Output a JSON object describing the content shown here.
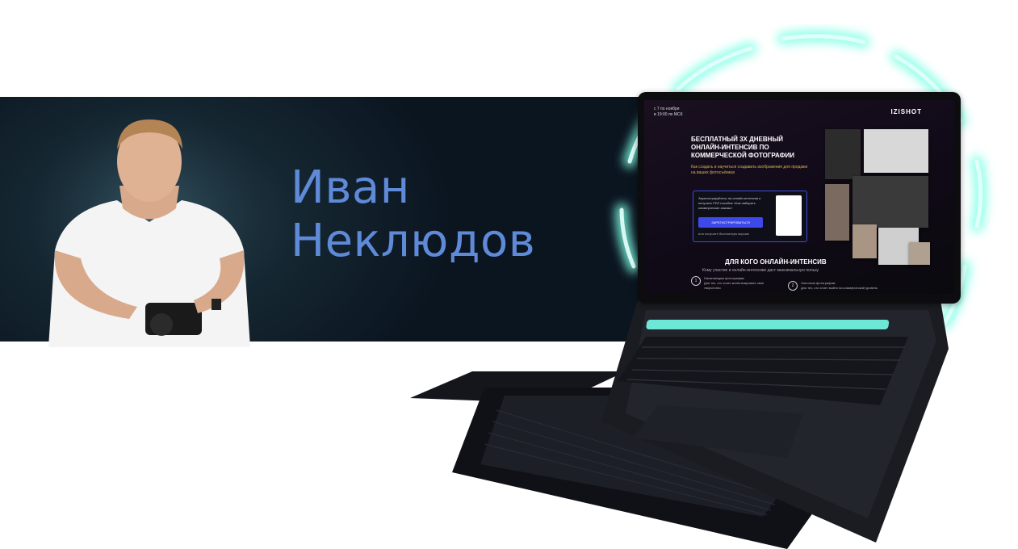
{
  "person": {
    "first_name": "Иван",
    "last_name": "Неклюдов"
  },
  "screen": {
    "date_line1": "с 7 по ноября",
    "date_line2": "в 19:00 по МСК",
    "logo": "IZISHOT",
    "headline": "БЕСПЛАТНЫЙ 3Х ДНЕВНЫЙ ОНЛАЙН-ИНТЕНСИВ ПО КОММЕРЧЕСКОЙ ФОТОГРАФИИ",
    "subheadline": "Как создать и научиться создавать изображения для продажи на ваших фотосъёмках",
    "card_text": "Зарегистрируйтесь на онлайн-интенсив и получите PDF-пособие «Как набирать коммерческие заказы»",
    "card_button": "ЗАРЕГИСТРИРОВАТЬСЯ",
    "card_footer": "или получите бесплатную версию",
    "section_title": "ДЛЯ КОГО ОНЛАЙН-ИНТЕНСИВ",
    "section_sub": "Кому участие в онлайн-интенсиве даст максимальную пользу",
    "items": [
      {
        "num": "1",
        "title": "Начинающим фотографам",
        "text": "Для тех, кто хочет монетизировать свое творчество"
      },
      {
        "num": "2",
        "title": "Опытным фотографам",
        "text": "Для тех, кто хочет выйти на коммерческий уровень"
      }
    ]
  },
  "colors": {
    "name_color": "#5f8ad8",
    "banner_bg": "#0b1520",
    "glow": "#7fffe6",
    "button": "#3d49e8"
  }
}
